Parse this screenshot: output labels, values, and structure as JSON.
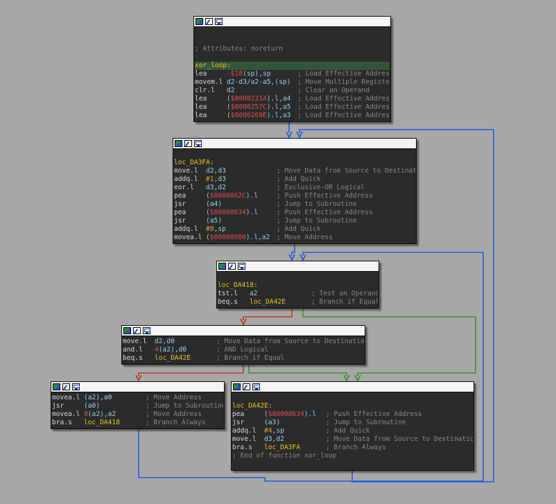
{
  "colors": {
    "background": "#a7a7a7",
    "node_bg": "#2b2b2b",
    "edge_normal": "#1f58e0",
    "edge_true": "#3c8f2a",
    "edge_false": "#b23a2a",
    "label": "#e8c420",
    "comment": "#8a8a8a",
    "operand": "#9ad2ee"
  },
  "header_icons": [
    "color-icon",
    "rename-icon",
    "graph-icon"
  ],
  "nodes": [
    {
      "id": "n0",
      "lines": [
        {
          "empty": true
        },
        {
          "empty": true
        },
        {
          "comment": "; Attributes: noreturn"
        },
        {
          "empty": true
        },
        {
          "label": "xor_loop:",
          "highlight": true
        },
        {
          "mn": "lea",
          "op": [
            [
              "addr",
              "-$18"
            ],
            [
              "reg",
              "(sp),sp"
            ]
          ],
          "cm": "; Load Effective Address"
        },
        {
          "mn": "movem.l",
          "op": [
            [
              "reg",
              "d2-d3/a2-a5,(sp)"
            ]
          ],
          "cm": "; Move Multiple Registers"
        },
        {
          "mn": "clr.l",
          "op": [
            [
              "reg",
              "d2"
            ]
          ],
          "cm": "; Clear an Operand"
        },
        {
          "mn": "lea",
          "op": [
            [
              "reg",
              "("
            ],
            [
              "addr",
              "$8000231A"
            ],
            [
              "reg",
              ").l,a4"
            ]
          ],
          "cm": "; Load Effective Address"
        },
        {
          "mn": "lea",
          "op": [
            [
              "reg",
              "("
            ],
            [
              "addr",
              "$8000257C"
            ],
            [
              "reg",
              ").l,a5"
            ]
          ],
          "cm": "; Load Effective Address"
        },
        {
          "mn": "lea",
          "op": [
            [
              "reg",
              "("
            ],
            [
              "addr",
              "$8000269E"
            ],
            [
              "reg",
              ").l,a3"
            ]
          ],
          "cm": "; Load Effective Address"
        }
      ]
    },
    {
      "id": "n1",
      "lines": [
        {
          "empty": true
        },
        {
          "label": "loc_DA3FA:"
        },
        {
          "mn": "move.l",
          "op": [
            [
              "reg",
              "d2,d3"
            ]
          ],
          "cm": "; Move Data from Source to Destination"
        },
        {
          "mn": "addq.l",
          "op": [
            [
              "num",
              "#1"
            ],
            [
              "reg",
              ",d3"
            ]
          ],
          "cm": "; Add Quick"
        },
        {
          "mn": "eor.l",
          "op": [
            [
              "reg",
              "d3,d2"
            ]
          ],
          "cm": "; Exclusive-OR Logical"
        },
        {
          "mn": "pea",
          "op": [
            [
              "reg",
              "("
            ],
            [
              "addr",
              "$8000862C"
            ],
            [
              "reg",
              ").l"
            ]
          ],
          "cm": "; Push Effective Address"
        },
        {
          "mn": "jsr",
          "op": [
            [
              "reg",
              "(a4)"
            ]
          ],
          "cm": "; Jump to Subroutine"
        },
        {
          "mn": "pea",
          "op": [
            [
              "reg",
              "("
            ],
            [
              "addr",
              "$80008634"
            ],
            [
              "reg",
              ").l"
            ]
          ],
          "cm": "; Push Effective Address"
        },
        {
          "mn": "jsr",
          "op": [
            [
              "reg",
              "(a5)"
            ]
          ],
          "cm": "; Jump to Subroutine"
        },
        {
          "mn": "addq.l",
          "op": [
            [
              "num",
              "#8"
            ],
            [
              "reg",
              ",sp"
            ]
          ],
          "cm": "; Add Quick"
        },
        {
          "mn": "movea.l",
          "op": [
            [
              "reg",
              "("
            ],
            [
              "addr",
              "$80008980"
            ],
            [
              "reg",
              ").l,a2"
            ]
          ],
          "cm": "; Move Address"
        }
      ]
    },
    {
      "id": "n2",
      "lines": [
        {
          "empty": true
        },
        {
          "label": "loc_DA418:"
        },
        {
          "mn": "tst.l",
          "op": [
            [
              "reg",
              "a2"
            ]
          ],
          "cm": "; Test an Operand"
        },
        {
          "mn": "beq.s",
          "op": [
            [
              "lbl",
              "loc_DA42E"
            ]
          ],
          "cm": "; Branch if Equal"
        }
      ]
    },
    {
      "id": "n3",
      "lines": [
        {
          "mn": "move.l",
          "op": [
            [
              "reg",
              "d2,d0"
            ]
          ],
          "cm": "; Move Data from Source to Destination"
        },
        {
          "mn": "and.l",
          "op": [
            [
              "addr",
              "4"
            ],
            [
              "reg",
              "(a2),d0"
            ]
          ],
          "cm": "; AND Logical"
        },
        {
          "mn": "beq.s",
          "op": [
            [
              "lbl",
              "loc_DA42E"
            ]
          ],
          "cm": "; Branch if Equal"
        }
      ]
    },
    {
      "id": "n4",
      "lines": [
        {
          "mn": "movea.l",
          "op": [
            [
              "reg",
              "(a2),a0"
            ]
          ],
          "cm": "; Move Address"
        },
        {
          "mn": "jsr",
          "op": [
            [
              "reg",
              "(a0)"
            ]
          ],
          "cm": "; Jump to Subroutine"
        },
        {
          "mn": "movea.l",
          "op": [
            [
              "addr",
              "8"
            ],
            [
              "reg",
              "(a2),a2"
            ]
          ],
          "cm": "; Move Address"
        },
        {
          "mn": "bra.s",
          "op": [
            [
              "lbl",
              "loc_DA418"
            ]
          ],
          "cm": "; Branch Always"
        }
      ]
    },
    {
      "id": "n5",
      "lines": [
        {
          "empty": true
        },
        {
          "label": "loc_DA42E:"
        },
        {
          "mn": "pea",
          "op": [
            [
              "reg",
              "("
            ],
            [
              "addr",
              "$80008634"
            ],
            [
              "reg",
              ").l"
            ]
          ],
          "cm": "; Push Effective Address"
        },
        {
          "mn": "jsr",
          "op": [
            [
              "reg",
              "(a3)"
            ]
          ],
          "cm": "; Jump to Subroutine"
        },
        {
          "mn": "addq.l",
          "op": [
            [
              "num",
              "#4"
            ],
            [
              "reg",
              ",sp"
            ]
          ],
          "cm": "; Add Quick"
        },
        {
          "mn": "move.l",
          "op": [
            [
              "reg",
              "d3,d2"
            ]
          ],
          "cm": "; Move Data from Source to Destination"
        },
        {
          "mn": "bra.s",
          "op": [
            [
              "lbl",
              "loc_DA3FA"
            ]
          ],
          "cm": "; Branch Always"
        },
        {
          "comment": "; End of function xor_loop"
        }
      ]
    }
  ],
  "edges": [
    {
      "from": "n0",
      "to": "n1",
      "kind": "normal"
    },
    {
      "from": "n1",
      "to": "n2",
      "kind": "normal"
    },
    {
      "from": "n2",
      "to": "n3",
      "kind": "false"
    },
    {
      "from": "n2",
      "to": "n5",
      "kind": "true"
    },
    {
      "from": "n3",
      "to": "n4",
      "kind": "false"
    },
    {
      "from": "n3",
      "to": "n5",
      "kind": "true"
    },
    {
      "from": "n4",
      "to": "n2",
      "kind": "normal"
    },
    {
      "from": "n5",
      "to": "n1",
      "kind": "normal"
    }
  ]
}
